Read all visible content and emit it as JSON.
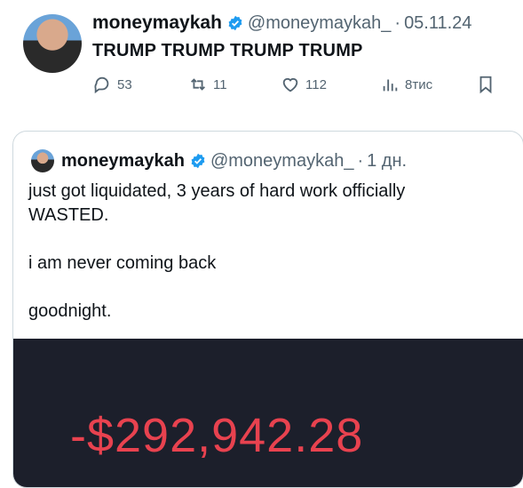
{
  "tweet": {
    "name": "moneymaykah",
    "handle": "@moneymaykah_",
    "separator": "·",
    "date": "05.11.24",
    "text": "TRUMP TRUMP TRUMP TRUMP",
    "actions": {
      "replies": "53",
      "retweets": "11",
      "likes": "112",
      "views": "8тис"
    }
  },
  "quote": {
    "name": "moneymaykah",
    "handle": "@moneymaykah_",
    "separator": "·",
    "time": "1 дн.",
    "lines": [
      "just got liquidated, 3 years of hard work officially WASTED.",
      "i am never coming back",
      "goodnight."
    ],
    "media_amount": "-$292,942.28"
  },
  "colors": {
    "verified": "#1d9bf0",
    "muted": "#536471",
    "loss": "#e8424f",
    "media_bg": "#1c1f2b"
  }
}
